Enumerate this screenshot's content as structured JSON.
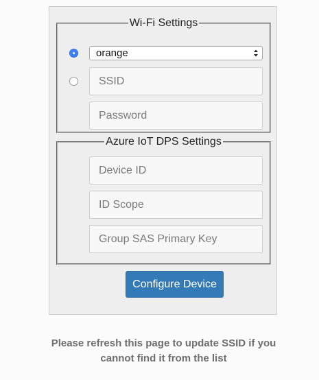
{
  "wifi": {
    "legend": "Wi-Fi Settings",
    "ssid_select_value": "orange",
    "ssid_placeholder": "SSID",
    "password_placeholder": "Password",
    "select_radio_checked": true,
    "manual_radio_checked": false
  },
  "azure": {
    "legend": "Azure IoT DPS Settings",
    "device_id_placeholder": "Device ID",
    "id_scope_placeholder": "ID Scope",
    "sas_key_placeholder": "Group SAS Primary Key"
  },
  "actions": {
    "configure_label": "Configure Device"
  },
  "note": "Please refresh this page to update SSID if you cannot find it from the list",
  "colors": {
    "accent": "#337ab7",
    "radio_selected": "#3b82f6"
  }
}
